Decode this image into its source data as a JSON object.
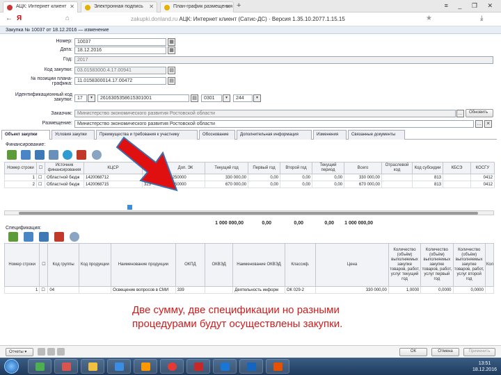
{
  "browser": {
    "tabs": [
      {
        "label": "АЦК: Интернет клиент"
      },
      {
        "label": "Электронная подпись"
      },
      {
        "label": "План-график размещения"
      }
    ],
    "new_tab": "+",
    "window_controls": "≡ _ ❐ ✕",
    "address_prefix": "zakupki.donland.ru",
    "address_title": " АЦК: Интернет клиент (Сатис-ДС) · Версия 1.35.10.2077.1.15.15",
    "back": "←",
    "yandex_letter": "Я"
  },
  "header": {
    "title": "Закупка № 10037 от 18.12.2016 — изменение"
  },
  "form": {
    "number_label": "Номер:",
    "number_value": "10037",
    "date_label": "Дата:",
    "date_value": "18.12.2016",
    "year_label": "Год:",
    "year_value": "2017",
    "purchase_code_label": "Код закупки:",
    "purchase_code_value": "03.01583000.4.17.00941",
    "plan_pos_label": "№ позиции плана-графика:",
    "plan_pos_value": "11.0158300014.17.00472",
    "ikz_label": "Идентификационный код закупки:",
    "ikz_year": "17",
    "ikz_main": "2616305358615301001",
    "ikz_part": "0301",
    "ikz_end": "244",
    "client_label": "Заказчик:",
    "client_value": "Министерство экономического развития Ростовской области",
    "client_btn": "Обновить",
    "placer_label": "Размещение:",
    "placer_value": "Министерство экономического развития Ростовской области"
  },
  "form_tabs": [
    "Объект закупки",
    "Условия закупки",
    "Преимущества и требования к участнику",
    "Обоснование",
    "Дополнительная информация",
    "Изменения",
    "Связанные документы"
  ],
  "financing": {
    "title": "Финансирование:",
    "headers": [
      "Номер строки",
      "",
      "Источник финансирования",
      "КЦСР",
      "КВР",
      "Доп. ЭК",
      "Текущий год",
      "Первый год",
      "Второй год",
      "Текущий период",
      "Всего",
      "Отраслевой код",
      "Код субсидии",
      "КБСЭ",
      "КОСГУ"
    ],
    "rows": [
      [
        "1",
        "",
        "Областной бюдж",
        "1420068712",
        "323",
        "82250000",
        "330 000,00",
        "0,00",
        "0,00",
        "0,00",
        "330 000,00",
        "",
        "813",
        "",
        "0412"
      ],
      [
        "2",
        "",
        "Областной бюдж",
        "1420068715",
        "323",
        "82250000",
        "670 000,00",
        "0,00",
        "0,00",
        "0,00",
        "670 000,00",
        "",
        "813",
        "",
        "0412"
      ]
    ],
    "totals": [
      "1 000 000,00",
      "0,00",
      "0,00",
      "0,00",
      "1 000 000,00"
    ]
  },
  "specification": {
    "title": "Спецификация:",
    "headers": [
      "Номер строки",
      "",
      "Код группы",
      "Код продукции",
      "Наименование продукции",
      "ОКПД",
      "ОКВЭД",
      "Наименование ОКВЭД",
      "Классиф.",
      "Цена",
      "Количество (объём) выполняемых закупке товаров, работ, услуг текущий год",
      "Количество (объём) выполняемых закупке товаров, работ, услуг первый год",
      "Количество (объём) выполняемых закупке товаров, работ, услуг второй год",
      "Кол"
    ],
    "rows": [
      [
        "1",
        "",
        "04",
        "",
        "Освещение вопросов в СМИ",
        "339",
        "",
        "Деятельность информ",
        "ОК 029-2",
        "330 000,00",
        "1,0000",
        "0,0000",
        "0,0000",
        ""
      ]
    ]
  },
  "caption": "Две сумму, две спецификации но разными процедурами будут осуществлены закупки.",
  "footer": {
    "left_btn": "Отчеты ▾",
    "ok_btn": "ОК",
    "cancel_btn": "Отмена",
    "apply_btn": "Применить"
  },
  "taskbar": {
    "time": "13:51",
    "date": "18.12.2016"
  },
  "colors": {
    "arrow": "#e01010",
    "caption": "#d31a1a",
    "taskbar": "#1f3a5c"
  }
}
